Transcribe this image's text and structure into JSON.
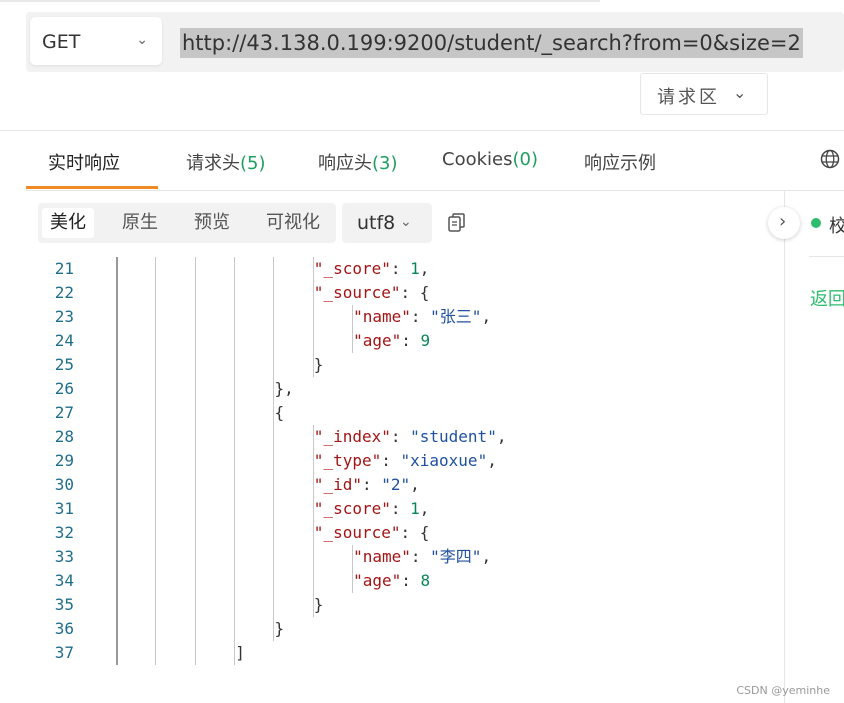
{
  "request": {
    "method": "GET",
    "url": "http://43.138.0.199:9200/student/_search?from=0&size=2",
    "zone_label": "请求区"
  },
  "tabs": [
    {
      "label": "实时响应",
      "count": ""
    },
    {
      "label": "请求头",
      "count": "(5)"
    },
    {
      "label": "响应头",
      "count": "(3)"
    },
    {
      "label": "Cookies",
      "count": "(0)"
    },
    {
      "label": "响应示例",
      "count": ""
    }
  ],
  "view_modes": [
    "美化",
    "原生",
    "预览",
    "可视化"
  ],
  "encoding": "utf8",
  "right_panel": {
    "title": "校",
    "link": "返回"
  },
  "code_lines": [
    {
      "n": "21",
      "indent": 6,
      "tokens": [
        [
          "k",
          "\"_score\""
        ],
        [
          "p",
          ": "
        ],
        [
          "n",
          "1"
        ],
        [
          "p",
          ","
        ]
      ]
    },
    {
      "n": "22",
      "indent": 6,
      "tokens": [
        [
          "k",
          "\"_source\""
        ],
        [
          "p",
          ": {"
        ]
      ]
    },
    {
      "n": "23",
      "indent": 7,
      "tokens": [
        [
          "k",
          "\"name\""
        ],
        [
          "p",
          ": "
        ],
        [
          "s",
          "\"张三\""
        ],
        [
          "p",
          ","
        ]
      ]
    },
    {
      "n": "24",
      "indent": 7,
      "tokens": [
        [
          "k",
          "\"age\""
        ],
        [
          "p",
          ": "
        ],
        [
          "n",
          "9"
        ]
      ]
    },
    {
      "n": "25",
      "indent": 6,
      "tokens": [
        [
          "p",
          "}"
        ]
      ]
    },
    {
      "n": "26",
      "indent": 5,
      "tokens": [
        [
          "p",
          "},"
        ]
      ]
    },
    {
      "n": "27",
      "indent": 5,
      "tokens": [
        [
          "p",
          "{"
        ]
      ]
    },
    {
      "n": "28",
      "indent": 6,
      "tokens": [
        [
          "k",
          "\"_index\""
        ],
        [
          "p",
          ": "
        ],
        [
          "s",
          "\"student\""
        ],
        [
          "p",
          ","
        ]
      ]
    },
    {
      "n": "29",
      "indent": 6,
      "tokens": [
        [
          "k",
          "\"_type\""
        ],
        [
          "p",
          ": "
        ],
        [
          "s",
          "\"xiaoxue\""
        ],
        [
          "p",
          ","
        ]
      ]
    },
    {
      "n": "30",
      "indent": 6,
      "tokens": [
        [
          "k",
          "\"_id\""
        ],
        [
          "p",
          ": "
        ],
        [
          "s",
          "\"2\""
        ],
        [
          "p",
          ","
        ]
      ]
    },
    {
      "n": "31",
      "indent": 6,
      "tokens": [
        [
          "k",
          "\"_score\""
        ],
        [
          "p",
          ": "
        ],
        [
          "n",
          "1"
        ],
        [
          "p",
          ","
        ]
      ]
    },
    {
      "n": "32",
      "indent": 6,
      "tokens": [
        [
          "k",
          "\"_source\""
        ],
        [
          "p",
          ": {"
        ]
      ]
    },
    {
      "n": "33",
      "indent": 7,
      "tokens": [
        [
          "k",
          "\"name\""
        ],
        [
          "p",
          ": "
        ],
        [
          "s",
          "\"李四\""
        ],
        [
          "p",
          ","
        ]
      ]
    },
    {
      "n": "34",
      "indent": 7,
      "tokens": [
        [
          "k",
          "\"age\""
        ],
        [
          "p",
          ": "
        ],
        [
          "n",
          "8"
        ]
      ]
    },
    {
      "n": "35",
      "indent": 6,
      "tokens": [
        [
          "p",
          "}"
        ]
      ]
    },
    {
      "n": "36",
      "indent": 5,
      "tokens": [
        [
          "p",
          "}"
        ]
      ]
    },
    {
      "n": "37",
      "indent": 4,
      "tokens": [
        [
          "p",
          "]"
        ]
      ]
    }
  ],
  "watermark": "CSDN @yeminhe",
  "colors": {
    "accent": "#f08a24",
    "count_green": "#20a060",
    "status_green": "#2dbd6e"
  }
}
